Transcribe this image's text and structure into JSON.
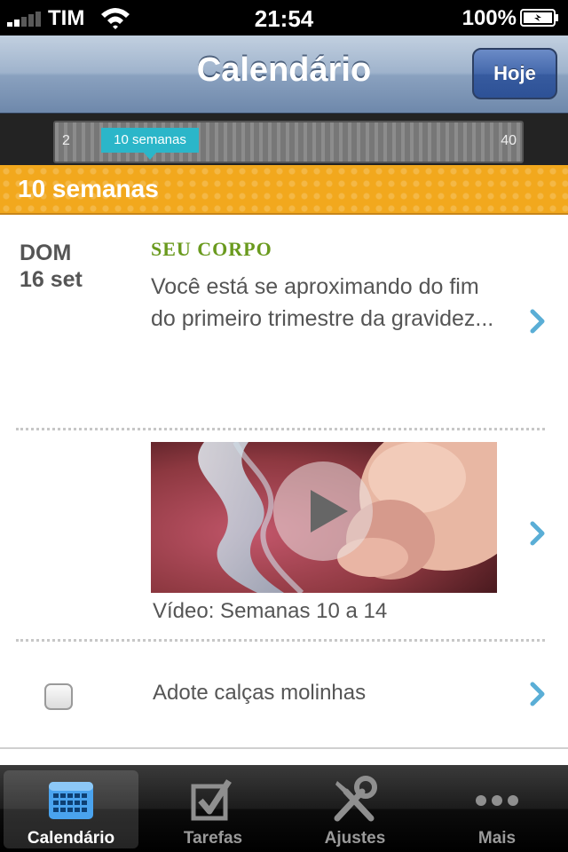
{
  "status_bar": {
    "carrier": "TIM",
    "time": "21:54",
    "battery": "100%"
  },
  "nav": {
    "title": "Calendário",
    "today_button": "Hoje"
  },
  "week_slider": {
    "min": "2",
    "max": "40",
    "current_label": "10 semanas"
  },
  "week_banner": "10 semanas",
  "day": {
    "weekday": "DOM",
    "date": "16 set"
  },
  "cards": {
    "body": {
      "heading": "SEU CORPO",
      "text": "Você está se aproximando do fim do primeiro trimestre da gravidez..."
    },
    "video": {
      "caption": "Vídeo: Semanas 10 a 14"
    },
    "task": {
      "label": "Adote calças molinhas",
      "checked": false
    }
  },
  "tabs": [
    {
      "label": "Calendário",
      "icon": "calendar-icon",
      "active": true
    },
    {
      "label": "Tarefas",
      "icon": "checkbox-icon",
      "active": false
    },
    {
      "label": "Ajustes",
      "icon": "tools-icon",
      "active": false
    },
    {
      "label": "Mais",
      "icon": "more-icon",
      "active": false
    }
  ],
  "colors": {
    "accent_orange": "#f2a81d",
    "heading_green": "#6a9a1e",
    "chevron_blue": "#5aaed6",
    "slider_teal": "#2bb6c9",
    "tab_active_blue": "#4aa3ee"
  }
}
